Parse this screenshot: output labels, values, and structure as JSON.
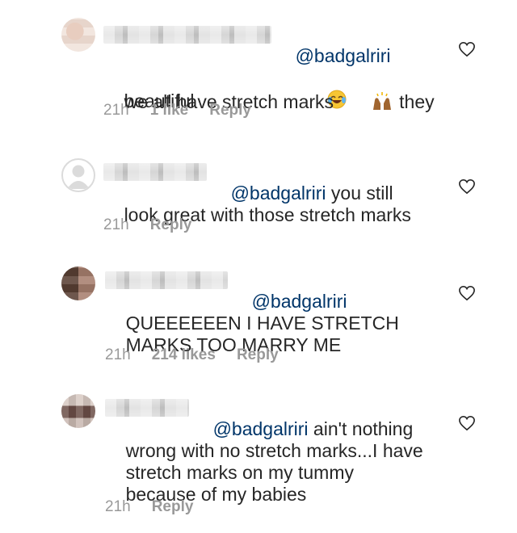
{
  "comments": [
    {
      "mention": "@badgalriri",
      "line1_after_mention_emoji": "laughing-tears-emoji",
      "body_part1": "we all have stretch marks ",
      "body_emoji": "raised-hands-emoji",
      "body_part2": " they",
      "body_line3": "beautiful",
      "time": "21h",
      "likes": "1 like",
      "reply": "Reply"
    },
    {
      "mention": "@badgalriri",
      "body_inline": " you still",
      "body_line2": "look great with those stretch marks",
      "time": "21h",
      "reply": "Reply"
    },
    {
      "mention": "@badgalriri",
      "body_line2": "QUEEEEEEN I HAVE STRETCH",
      "body_line3": "MARKS TOO MARRY ME",
      "time": "21h",
      "likes": "214 likes",
      "reply": "Reply"
    },
    {
      "mention": "@badgalriri",
      "body_inline": " ain't nothing",
      "body_line2": "wrong with no stretch marks...I have",
      "body_line3": "stretch marks on my tummy",
      "body_line4": "because of my babies",
      "time": "21h",
      "reply": "Reply"
    }
  ],
  "colors": {
    "mention": "#003569",
    "meta": "#999999",
    "text": "#262626",
    "heart": "#262626"
  }
}
